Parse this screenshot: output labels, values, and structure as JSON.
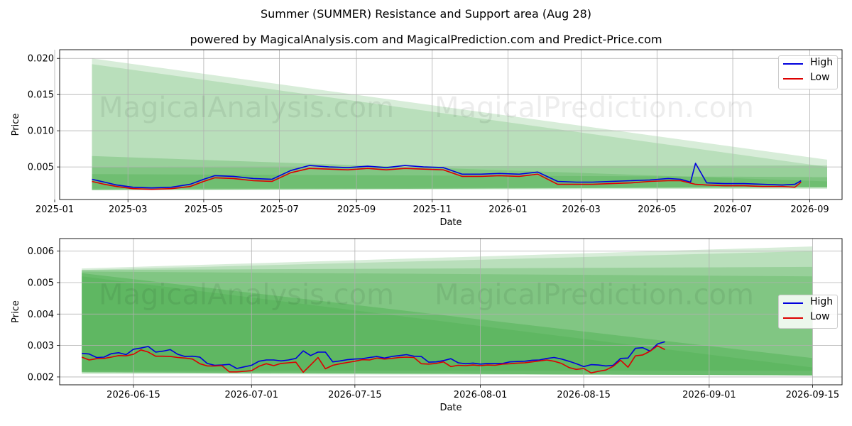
{
  "figure": {
    "title": "Summer (SUMMER) Resistance and Support area (Aug 28)",
    "subtitle": "powered by MagicalAnalysis.com and MagicalPrediction.com and Predict-Price.com",
    "watermarks": [
      "MagicalAnalysis.com",
      "MagicalPrediction.com"
    ]
  },
  "colors": {
    "high": "#0000dd",
    "low": "#dd0000",
    "band": "#4caf50",
    "grid": "#b0b0b0"
  },
  "chart_data": [
    {
      "type": "line",
      "xlabel": "Date",
      "ylabel": "Price",
      "grid": true,
      "legend_position": "top-right",
      "xlim": [
        "2025-01-05",
        "2026-09-27"
      ],
      "ylim": [
        0.0005,
        0.0212
      ],
      "xticks": [
        "2025-01",
        "2025-03",
        "2025-05",
        "2025-07",
        "2025-09",
        "2025-11",
        "2026-01",
        "2026-03",
        "2026-05",
        "2026-07",
        "2026-09"
      ],
      "yticks": [
        "0.020",
        "0.015",
        "0.010",
        "0.005"
      ],
      "series": [
        {
          "name": "High",
          "color": "#0000dd",
          "x": [
            "2025-01-31",
            "2025-02-10",
            "2025-02-20",
            "2025-03-05",
            "2025-03-20",
            "2025-04-05",
            "2025-04-20",
            "2025-05-01",
            "2025-05-10",
            "2025-05-25",
            "2025-06-10",
            "2025-06-25",
            "2025-07-10",
            "2025-07-25",
            "2025-08-10",
            "2025-08-25",
            "2025-09-10",
            "2025-09-25",
            "2025-10-10",
            "2025-10-25",
            "2025-11-10",
            "2025-11-25",
            "2025-12-10",
            "2025-12-25",
            "2026-01-10",
            "2026-01-25",
            "2026-02-10",
            "2026-02-25",
            "2026-03-10",
            "2026-03-25",
            "2026-04-10",
            "2026-04-25",
            "2026-05-10",
            "2026-05-20",
            "2026-05-28",
            "2026-06-01",
            "2026-06-10",
            "2026-06-25",
            "2026-07-10",
            "2026-07-25",
            "2026-08-10",
            "2026-08-20",
            "2026-08-25"
          ],
          "values": [
            0.0033,
            0.0029,
            0.0025,
            0.0022,
            0.0021,
            0.0022,
            0.0026,
            0.0033,
            0.0038,
            0.0037,
            0.0034,
            0.0033,
            0.0045,
            0.0052,
            0.005,
            0.0049,
            0.0051,
            0.0049,
            0.0052,
            0.005,
            0.0049,
            0.004,
            0.004,
            0.0041,
            0.004,
            0.0043,
            0.003,
            0.0029,
            0.0029,
            0.003,
            0.0031,
            0.0032,
            0.0034,
            0.0033,
            0.0029,
            0.0055,
            0.0028,
            0.0027,
            0.0027,
            0.0026,
            0.0025,
            0.0026,
            0.0031
          ]
        },
        {
          "name": "Low",
          "color": "#dd0000",
          "x": [
            "2025-01-31",
            "2025-02-10",
            "2025-02-20",
            "2025-03-05",
            "2025-03-20",
            "2025-04-05",
            "2025-04-20",
            "2025-05-01",
            "2025-05-10",
            "2025-05-25",
            "2025-06-10",
            "2025-06-25",
            "2025-07-10",
            "2025-07-25",
            "2025-08-10",
            "2025-08-25",
            "2025-09-10",
            "2025-09-25",
            "2025-10-10",
            "2025-10-25",
            "2025-11-10",
            "2025-11-25",
            "2025-12-10",
            "2025-12-25",
            "2026-01-10",
            "2026-01-25",
            "2026-02-10",
            "2026-02-25",
            "2026-03-10",
            "2026-03-25",
            "2026-04-10",
            "2026-04-25",
            "2026-05-10",
            "2026-05-20",
            "2026-06-01",
            "2026-06-10",
            "2026-06-25",
            "2026-07-10",
            "2026-07-25",
            "2026-08-10",
            "2026-08-20",
            "2026-08-25"
          ],
          "values": [
            0.003,
            0.0026,
            0.0023,
            0.002,
            0.0019,
            0.002,
            0.0023,
            0.003,
            0.0035,
            0.0034,
            0.0031,
            0.003,
            0.0042,
            0.0048,
            0.0047,
            0.0046,
            0.0048,
            0.0046,
            0.0048,
            0.0047,
            0.0046,
            0.0037,
            0.0037,
            0.0038,
            0.0037,
            0.004,
            0.0026,
            0.0026,
            0.0026,
            0.0027,
            0.0028,
            0.003,
            0.0031,
            0.0031,
            0.0026,
            0.0025,
            0.0024,
            0.0024,
            0.0023,
            0.0023,
            0.0022,
            0.0029
          ]
        }
      ]
    },
    {
      "type": "line",
      "xlabel": "Date",
      "ylabel": "Price",
      "grid": true,
      "legend_position": "center-right",
      "xlim": [
        "2026-06-05",
        "2026-09-19"
      ],
      "ylim": [
        0.00175,
        0.0064
      ],
      "xticks": [
        "2026-06-15",
        "2026-07-01",
        "2026-07-15",
        "2026-08-01",
        "2026-08-15",
        "2026-09-01",
        "2026-09-15"
      ],
      "yticks": [
        "0.006",
        "0.005",
        "0.004",
        "0.003",
        "0.002"
      ],
      "series": [
        {
          "name": "High",
          "color": "#0000dd",
          "x": [
            "2026-06-08",
            "2026-06-09",
            "2026-06-10",
            "2026-06-11",
            "2026-06-12",
            "2026-06-13",
            "2026-06-14",
            "2026-06-15",
            "2026-06-16",
            "2026-06-17",
            "2026-06-18",
            "2026-06-19",
            "2026-06-20",
            "2026-06-21",
            "2026-06-22",
            "2026-06-23",
            "2026-06-24",
            "2026-06-25",
            "2026-06-26",
            "2026-06-27",
            "2026-06-28",
            "2026-06-29",
            "2026-06-30",
            "2026-07-01",
            "2026-07-02",
            "2026-07-03",
            "2026-07-04",
            "2026-07-05",
            "2026-07-06",
            "2026-07-07",
            "2026-07-08",
            "2026-07-09",
            "2026-07-10",
            "2026-07-11",
            "2026-07-12",
            "2026-07-13",
            "2026-07-14",
            "2026-07-15",
            "2026-07-16",
            "2026-07-17",
            "2026-07-18",
            "2026-07-19",
            "2026-07-20",
            "2026-07-21",
            "2026-07-22",
            "2026-07-23",
            "2026-07-24",
            "2026-07-25",
            "2026-07-26",
            "2026-07-27",
            "2026-07-28",
            "2026-07-29",
            "2026-07-30",
            "2026-07-31",
            "2026-08-01",
            "2026-08-02",
            "2026-08-03",
            "2026-08-04",
            "2026-08-05",
            "2026-08-06",
            "2026-08-07",
            "2026-08-08",
            "2026-08-09",
            "2026-08-10",
            "2026-08-11",
            "2026-08-12",
            "2026-08-13",
            "2026-08-14",
            "2026-08-15",
            "2026-08-16",
            "2026-08-17",
            "2026-08-18",
            "2026-08-19",
            "2026-08-20",
            "2026-08-21",
            "2026-08-22",
            "2026-08-23",
            "2026-08-24",
            "2026-08-25",
            "2026-08-26"
          ],
          "values": [
            0.00275,
            0.00273,
            0.00262,
            0.00263,
            0.00274,
            0.00277,
            0.00271,
            0.00288,
            0.00292,
            0.00297,
            0.00279,
            0.00282,
            0.00287,
            0.00272,
            0.00265,
            0.00266,
            0.00263,
            0.00243,
            0.00237,
            0.00238,
            0.0024,
            0.00227,
            0.00232,
            0.00237,
            0.0025,
            0.00254,
            0.00254,
            0.00251,
            0.00254,
            0.00259,
            0.00283,
            0.00268,
            0.00279,
            0.00279,
            0.00248,
            0.00251,
            0.00255,
            0.00257,
            0.00258,
            0.00262,
            0.00265,
            0.0026,
            0.00265,
            0.00268,
            0.00271,
            0.00266,
            0.00265,
            0.00247,
            0.00248,
            0.00252,
            0.00258,
            0.00245,
            0.00242,
            0.00244,
            0.00241,
            0.00243,
            0.00243,
            0.00243,
            0.00248,
            0.00249,
            0.0025,
            0.00253,
            0.00254,
            0.00259,
            0.00262,
            0.00257,
            0.0025,
            0.00242,
            0.00233,
            0.00239,
            0.00238,
            0.00235,
            0.00237,
            0.00259,
            0.0026,
            0.00291,
            0.00293,
            0.00282,
            0.00305,
            0.00312
          ]
        },
        {
          "name": "Low",
          "color": "#dd0000",
          "x": [
            "2026-06-08",
            "2026-06-09",
            "2026-06-10",
            "2026-06-11",
            "2026-06-12",
            "2026-06-13",
            "2026-06-14",
            "2026-06-15",
            "2026-06-16",
            "2026-06-17",
            "2026-06-18",
            "2026-06-19",
            "2026-06-20",
            "2026-06-21",
            "2026-06-22",
            "2026-06-23",
            "2026-06-24",
            "2026-06-25",
            "2026-06-26",
            "2026-06-27",
            "2026-06-28",
            "2026-06-29",
            "2026-06-30",
            "2026-07-01",
            "2026-07-02",
            "2026-07-03",
            "2026-07-04",
            "2026-07-05",
            "2026-07-06",
            "2026-07-07",
            "2026-07-08",
            "2026-07-09",
            "2026-07-10",
            "2026-07-11",
            "2026-07-12",
            "2026-07-13",
            "2026-07-14",
            "2026-07-15",
            "2026-07-16",
            "2026-07-17",
            "2026-07-18",
            "2026-07-19",
            "2026-07-20",
            "2026-07-21",
            "2026-07-22",
            "2026-07-23",
            "2026-07-24",
            "2026-07-25",
            "2026-07-26",
            "2026-07-27",
            "2026-07-28",
            "2026-07-29",
            "2026-07-30",
            "2026-07-31",
            "2026-08-01",
            "2026-08-02",
            "2026-08-03",
            "2026-08-04",
            "2026-08-05",
            "2026-08-06",
            "2026-08-07",
            "2026-08-08",
            "2026-08-09",
            "2026-08-10",
            "2026-08-11",
            "2026-08-12",
            "2026-08-13",
            "2026-08-14",
            "2026-08-15",
            "2026-08-16",
            "2026-08-17",
            "2026-08-18",
            "2026-08-19",
            "2026-08-20",
            "2026-08-21",
            "2026-08-22",
            "2026-08-23",
            "2026-08-24",
            "2026-08-25",
            "2026-08-26"
          ],
          "values": [
            0.00263,
            0.00254,
            0.00258,
            0.00259,
            0.00263,
            0.00268,
            0.00267,
            0.00272,
            0.00286,
            0.00279,
            0.00266,
            0.00266,
            0.00265,
            0.00262,
            0.0026,
            0.00257,
            0.00242,
            0.00235,
            0.00235,
            0.00236,
            0.00216,
            0.00216,
            0.00218,
            0.0022,
            0.00234,
            0.00242,
            0.00236,
            0.00243,
            0.00245,
            0.00247,
            0.00215,
            0.00238,
            0.00262,
            0.00226,
            0.00237,
            0.00242,
            0.00246,
            0.0025,
            0.00255,
            0.00254,
            0.0026,
            0.00257,
            0.00259,
            0.00262,
            0.00263,
            0.00262,
            0.00242,
            0.00241,
            0.00243,
            0.00248,
            0.00233,
            0.00237,
            0.00236,
            0.00238,
            0.00236,
            0.00238,
            0.00237,
            0.00241,
            0.00242,
            0.00244,
            0.00245,
            0.00248,
            0.00251,
            0.00254,
            0.0025,
            0.00243,
            0.0023,
            0.00224,
            0.00227,
            0.00213,
            0.00218,
            0.00222,
            0.00234,
            0.00253,
            0.00231,
            0.00267,
            0.0027,
            0.00282,
            0.00299,
            0.00287
          ]
        }
      ]
    }
  ]
}
